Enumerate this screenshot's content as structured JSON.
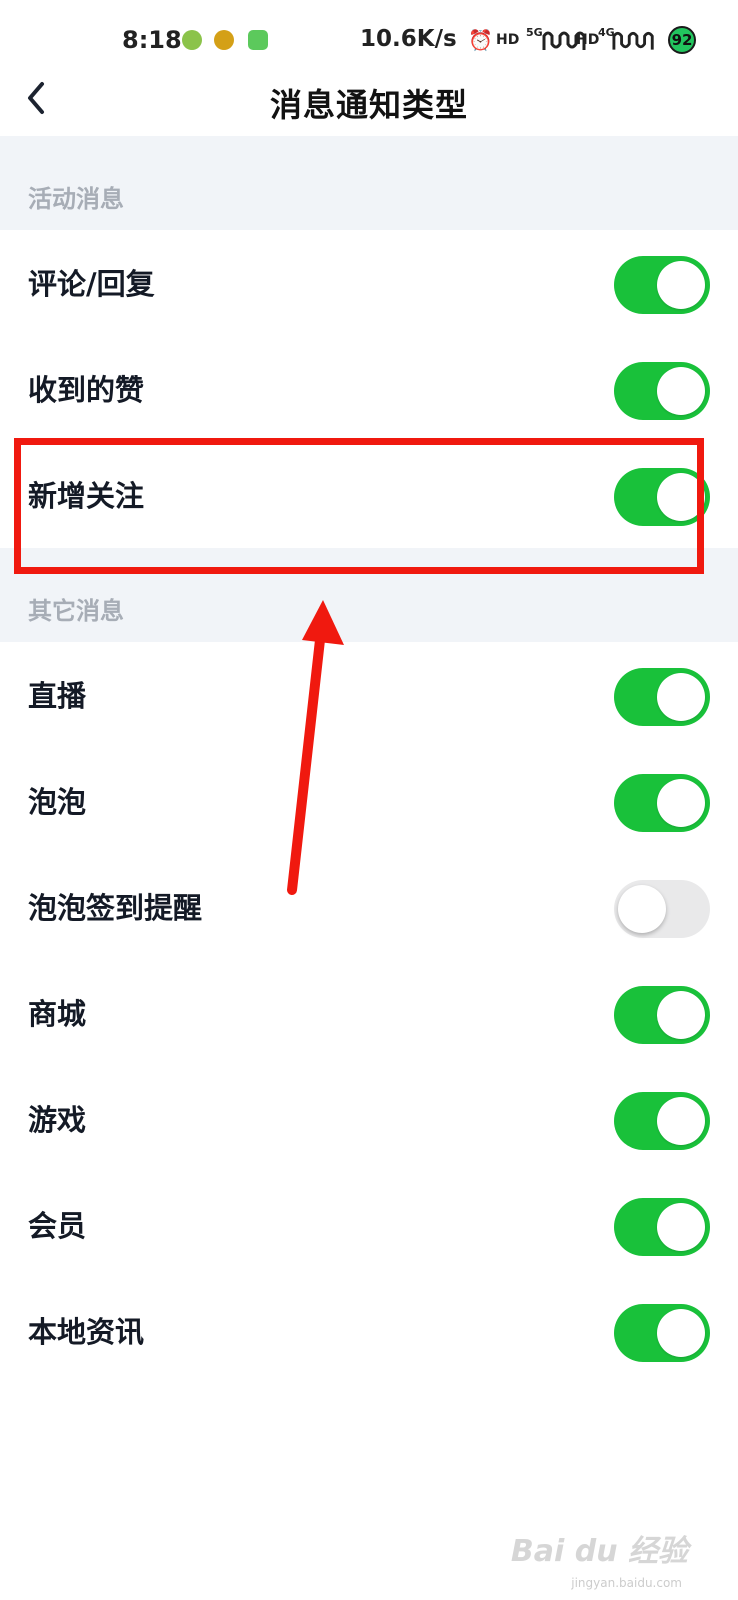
{
  "status_bar": {
    "time": "8:18",
    "network_speed": "10.6K/s",
    "signal_5g": "5G",
    "signal_4g": "4G",
    "battery": "92",
    "icons": [
      "app-icon-1",
      "app-icon-2",
      "app-icon-3",
      "alarm-icon",
      "hd-icon",
      "signal-icon"
    ]
  },
  "header": {
    "title": "消息通知类型",
    "back_icon": "chevron-left-icon"
  },
  "sections": [
    {
      "title": "活动消息",
      "items": [
        {
          "label": "评论/回复",
          "enabled": true
        },
        {
          "label": "收到的赞",
          "enabled": true
        },
        {
          "label": "新增关注",
          "enabled": true
        }
      ]
    },
    {
      "title": "其它消息",
      "items": [
        {
          "label": "直播",
          "enabled": true
        },
        {
          "label": "泡泡",
          "enabled": true
        },
        {
          "label": "泡泡签到提醒",
          "enabled": false
        },
        {
          "label": "商城",
          "enabled": true
        },
        {
          "label": "游戏",
          "enabled": true
        },
        {
          "label": "会员",
          "enabled": true
        },
        {
          "label": "本地资讯",
          "enabled": true
        }
      ]
    }
  ],
  "colors": {
    "toggle_on": "#19c13a",
    "toggle_off": "#e9e9ea",
    "section_bg": "#f1f4f8",
    "annotation_red": "#f0190f"
  },
  "watermark": {
    "text": "Bai du 经验",
    "sub": "jingyan.baidu.com"
  }
}
